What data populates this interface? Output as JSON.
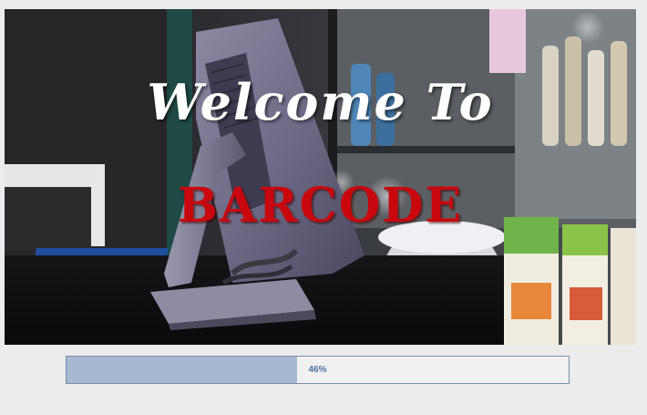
{
  "splash": {
    "welcome_text": "Welcome To",
    "brand_text": "BARCODE"
  },
  "progress": {
    "value_percent": 46,
    "label": "46%"
  },
  "colors": {
    "background": "#ececec",
    "brand_red": "#c8080e",
    "progress_fill": "#a7b9d1",
    "progress_border": "#7a8ea8",
    "progress_text": "#4a6fa5"
  }
}
